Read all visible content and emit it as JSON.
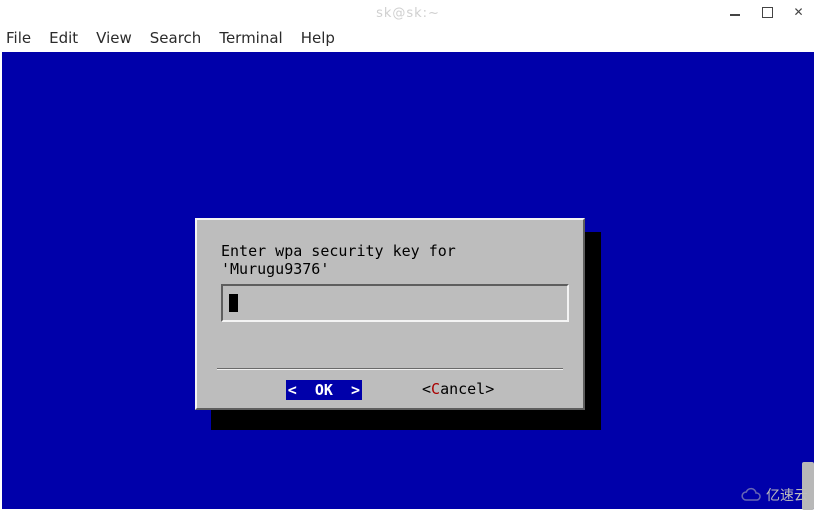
{
  "window": {
    "title": "sk@sk:~",
    "controls": {
      "minimize": "Minimize",
      "maximize": "Maximize",
      "close": "Close"
    }
  },
  "menubar": {
    "items": [
      "File",
      "Edit",
      "View",
      "Search",
      "Terminal",
      "Help"
    ]
  },
  "dialog": {
    "prompt_line1": "Enter wpa security key for",
    "prompt_line2": "'Murugu9376'",
    "input_value": "",
    "ok_label": "<  OK  >",
    "cancel_prefix": "<",
    "cancel_hot": "C",
    "cancel_rest": "ancel>",
    "selected_button": "ok"
  },
  "watermark": {
    "text": "亿速云"
  }
}
